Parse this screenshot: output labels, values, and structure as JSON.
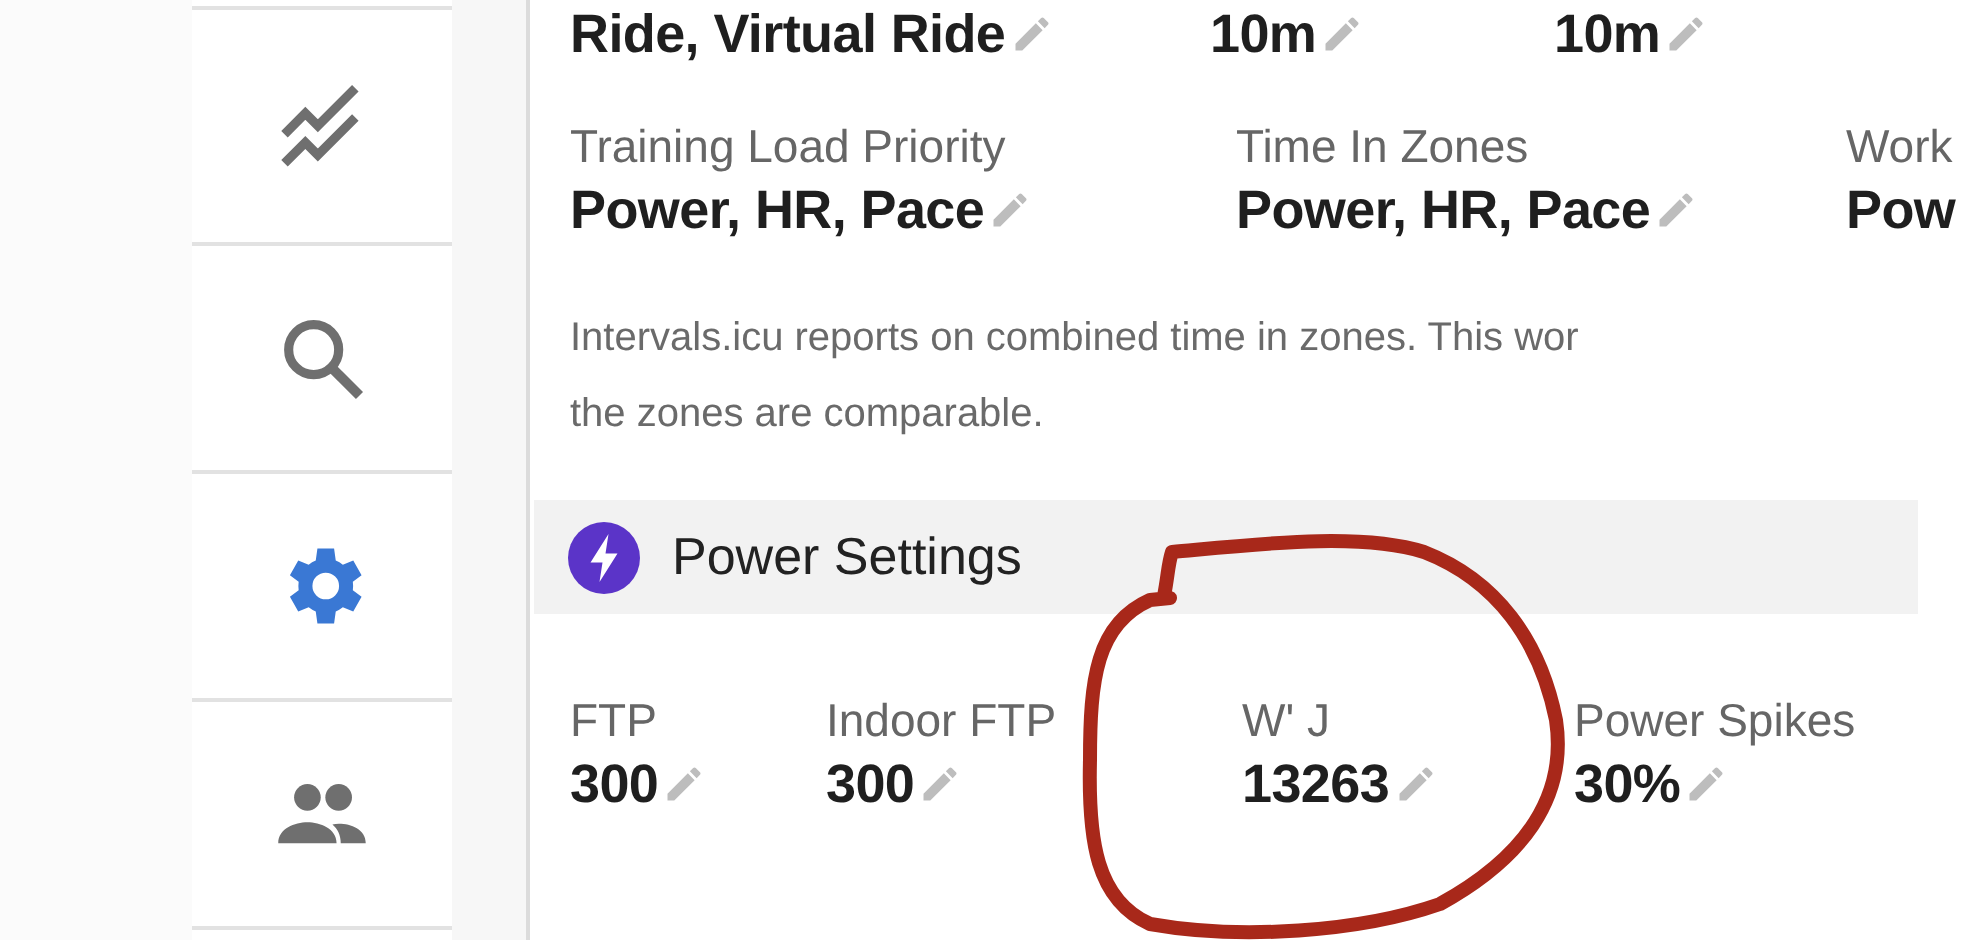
{
  "sidebar": {
    "items": [
      {
        "kind": "chart",
        "selected": false
      },
      {
        "kind": "search",
        "selected": false
      },
      {
        "kind": "settings",
        "selected": true
      },
      {
        "kind": "people",
        "selected": false
      }
    ]
  },
  "top_row": {
    "values": [
      "Ride, Virtual Ride",
      "10m",
      "10m"
    ]
  },
  "priority_row": {
    "fields": [
      {
        "label": "Training Load Priority",
        "value": "Power, HR, Pace",
        "editable": true
      },
      {
        "label": "Time In Zones",
        "value": "Power, HR, Pace",
        "editable": true
      },
      {
        "label": "Work",
        "value": "Pow",
        "editable": false
      }
    ]
  },
  "zones_note": "Intervals.icu reports on combined time in zones. This wor\nthe zones are comparable.",
  "power_settings": {
    "title": "Power Settings",
    "fields": [
      {
        "label": "FTP",
        "value": "300",
        "editable": true
      },
      {
        "label": "Indoor FTP",
        "value": "300",
        "editable": true
      },
      {
        "label": "W' J",
        "value": "13263",
        "editable": true
      },
      {
        "label": "Power Spikes",
        "value": "30%",
        "editable": true
      }
    ]
  }
}
